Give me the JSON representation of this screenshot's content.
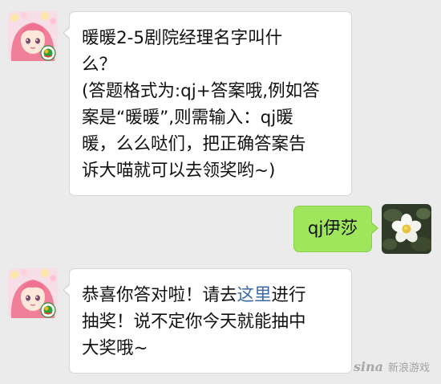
{
  "messages": [
    {
      "sender": "incoming",
      "avatar_icon": "anime-girl-avatar-icon",
      "lines": [
        "暖暖2-5剧院经理名字叫什",
        "么？",
        "(答题格式为:qj+答案哦,例如答",
        "案是“暖暖”,则需输入：qj暖",
        "暖，么么哒们，把正确答案告",
        "诉大喵就可以去领奖哟~)"
      ]
    },
    {
      "sender": "outgoing",
      "avatar_icon": "white-flower-avatar-icon",
      "text": "qj伊莎"
    },
    {
      "sender": "incoming",
      "avatar_icon": "anime-girl-avatar-icon",
      "line1_before": "恭喜你答对啦！请去",
      "line1_link": "这里",
      "line1_after": "进行",
      "lines_rest": [
        "抽奖！说不定你今天就能抽中",
        "大奖哦~"
      ]
    }
  ],
  "watermark": {
    "logo": "sina",
    "text": "新浪游戏"
  },
  "colors": {
    "background": "#ebebeb",
    "incoming_bubble": "#ffffff",
    "outgoing_bubble": "#a0e65c",
    "link": "#3a6aa8"
  }
}
